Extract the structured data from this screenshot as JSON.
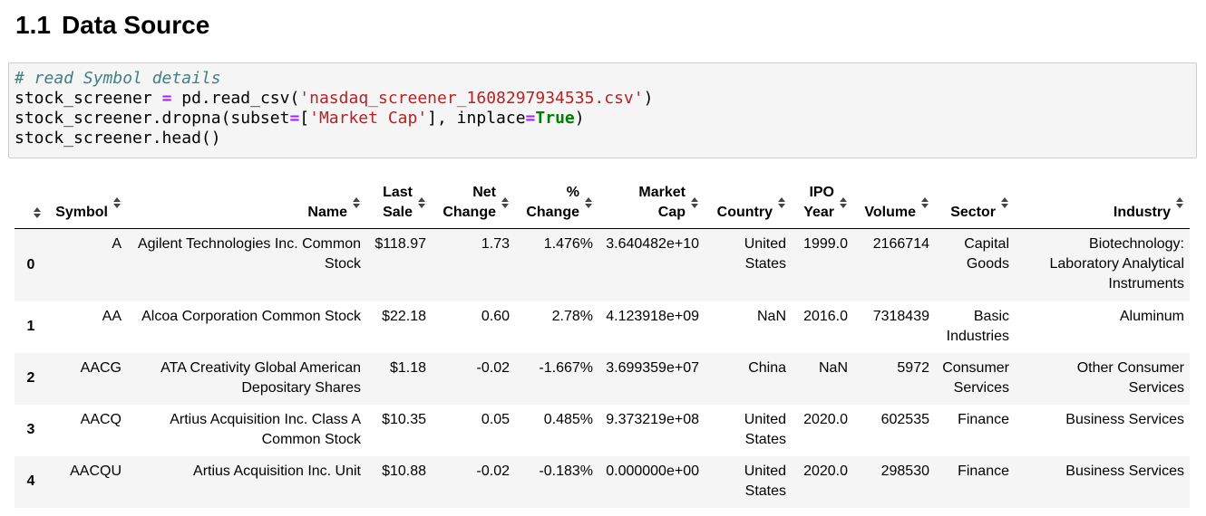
{
  "heading": {
    "number": "1.1",
    "title": "Data Source"
  },
  "code": {
    "comment": "# read Symbol details",
    "line2_var": "stock_screener ",
    "line2_op": "=",
    "line2_mid": " pd.read_csv(",
    "line2_str": "'nasdaq_screener_1608297934535.csv'",
    "line2_end": ")",
    "line3_start": "stock_screener.dropna(subset",
    "line3_op1": "=",
    "line3_mid": "[",
    "line3_str": "'Market Cap'",
    "line3_mid2": "], inplace",
    "line3_op2": "=",
    "line3_kw": "True",
    "line3_end": ")",
    "line4": "stock_screener.head()"
  },
  "table": {
    "columns": [
      {
        "line1": "",
        "line2": ""
      },
      {
        "line1": "",
        "line2": "Symbol"
      },
      {
        "line1": "",
        "line2": "Name"
      },
      {
        "line1": "Last",
        "line2": "Sale"
      },
      {
        "line1": "Net",
        "line2": "Change"
      },
      {
        "line1": "%",
        "line2": "Change"
      },
      {
        "line1": "Market",
        "line2": "Cap"
      },
      {
        "line1": "",
        "line2": "Country"
      },
      {
        "line1": "IPO",
        "line2": "Year"
      },
      {
        "line1": "",
        "line2": "Volume"
      },
      {
        "line1": "",
        "line2": "Sector"
      },
      {
        "line1": "",
        "line2": "Industry"
      }
    ],
    "rows": [
      [
        "0",
        "A",
        "Agilent Technologies Inc. Common Stock",
        "$118.97",
        "1.73",
        "1.476%",
        "3.640482e+10",
        "United States",
        "1999.0",
        "2166714",
        "Capital Goods",
        "Biotechnology: Laboratory Analytical Instruments"
      ],
      [
        "1",
        "AA",
        "Alcoa Corporation Common Stock",
        "$22.18",
        "0.60",
        "2.78%",
        "4.123918e+09",
        "NaN",
        "2016.0",
        "7318439",
        "Basic Industries",
        "Aluminum"
      ],
      [
        "2",
        "AACG",
        "ATA Creativity Global American Depositary Shares",
        "$1.18",
        "-0.02",
        "-1.667%",
        "3.699359e+07",
        "China",
        "NaN",
        "5972",
        "Consumer Services",
        "Other Consumer Services"
      ],
      [
        "3",
        "AACQ",
        "Artius Acquisition Inc. Class A Common Stock",
        "$10.35",
        "0.05",
        "0.485%",
        "9.373219e+08",
        "United States",
        "2020.0",
        "602535",
        "Finance",
        "Business Services"
      ],
      [
        "4",
        "AACQU",
        "Artius Acquisition Inc. Unit",
        "$10.88",
        "-0.02",
        "-0.183%",
        "0.000000e+00",
        "United States",
        "2020.0",
        "298530",
        "Finance",
        "Business Services"
      ]
    ]
  }
}
